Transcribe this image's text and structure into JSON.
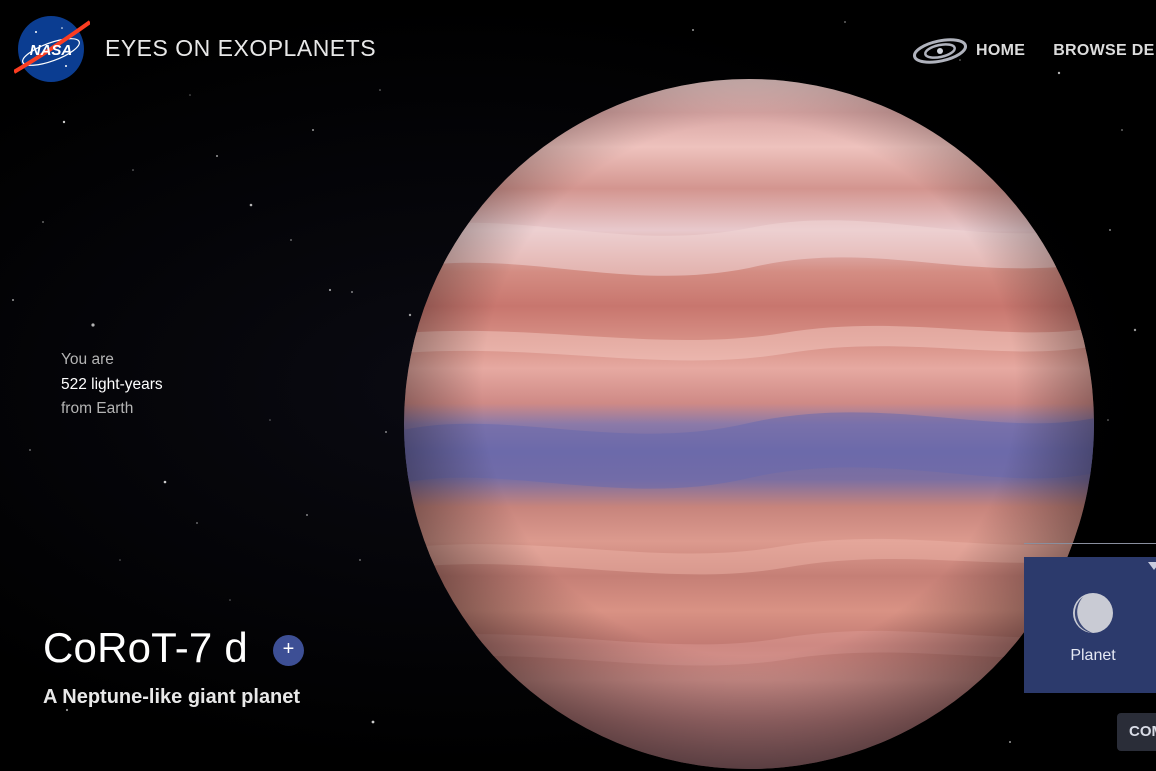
{
  "header": {
    "logo_text": "NASA",
    "app_title": "EYES ON EXOPLANETS",
    "nav": {
      "galaxy_icon": "galaxy-icon",
      "home_label": "HOME",
      "browse_label": "BROWSE DE"
    }
  },
  "distance": {
    "line1": "You are",
    "line2": "522 light-years",
    "line3": "from Earth"
  },
  "planet": {
    "name": "CoRoT-7 d",
    "subtitle": "A Neptune-like giant planet",
    "more_button": "+"
  },
  "panel": {
    "type_icon": "planet-icon",
    "type_label": "Planet",
    "compare_label": "COMPARE"
  },
  "colors": {
    "background": "#000000",
    "card": "#2c3a6c",
    "plus_button": "#3d4f95",
    "planet_base": "#d7867f",
    "planet_band": "#6f6aa6"
  }
}
